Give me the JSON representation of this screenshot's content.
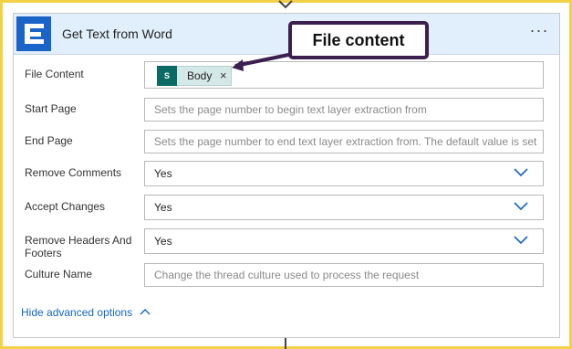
{
  "card": {
    "title": "Get Text from Word",
    "more_menu": "···"
  },
  "fields": [
    {
      "label": "File Content",
      "token": {
        "label": "Body",
        "close": "×",
        "icon": "sharepoint-icon",
        "icon_text": "S"
      }
    },
    {
      "label": "Start Page",
      "placeholder": "Sets the page number to begin text layer extraction from"
    },
    {
      "label": "End Page",
      "placeholder": "Sets the page number to end text layer extraction from. The default value is set"
    },
    {
      "label": "Remove Comments",
      "value": "Yes"
    },
    {
      "label": "Accept Changes",
      "value": "Yes"
    },
    {
      "label": "Remove Headers And Footers",
      "value": "Yes"
    },
    {
      "label": "Culture Name",
      "placeholder": "Change the thread culture used to process the request"
    }
  ],
  "advanced": {
    "label": "Hide advanced options"
  },
  "callout": {
    "label": "File content"
  },
  "colors": {
    "frame": "#f3d147",
    "header_bg": "#e1eefb",
    "app_icon": "#1a63c7",
    "link": "#1566c0",
    "callout_border": "#3c1f4f",
    "token_bg": "#d5e8e8"
  }
}
